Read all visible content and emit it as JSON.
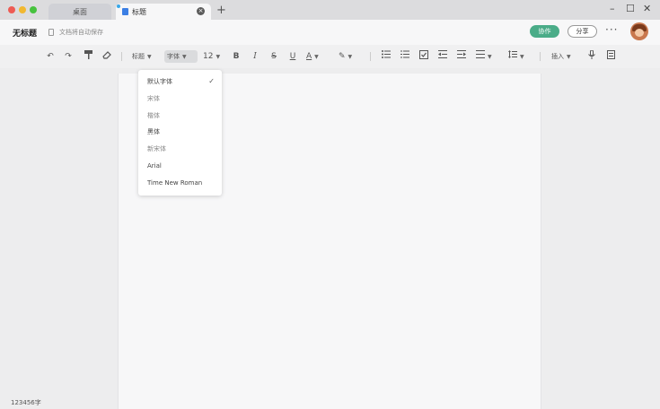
{
  "tabs": [
    {
      "label": "桌面",
      "active": false
    },
    {
      "label": "标题",
      "active": true
    }
  ],
  "window": {
    "new_tab": "+",
    "minimize": "–",
    "maximize": "☐",
    "close": "✕"
  },
  "header": {
    "title": "无标题",
    "autosave": "文档将自动保存",
    "collab_label": "协作",
    "share_label": "分享",
    "more": "···"
  },
  "toolbar": {
    "undo": "↶",
    "redo": "↷",
    "format_painter": "🖌",
    "eraser": "⌫",
    "heading": "标题",
    "font": "字体",
    "size": "12",
    "bold": "B",
    "italic": "I",
    "strike": "S",
    "underline": "U",
    "font_color": "A",
    "highlight": "✎",
    "insert": "插入"
  },
  "font_menu": {
    "items": [
      "默认字体",
      "宋体",
      "楷体",
      "黑体",
      "新宋体",
      "Arial",
      "Time New Roman"
    ],
    "selected_index": 0
  },
  "status": {
    "word_count": "123456字"
  },
  "colors": {
    "accent": "#4aac88",
    "tab_dot": "#3aa8e8",
    "doc_icon": "#3c7fe4"
  }
}
